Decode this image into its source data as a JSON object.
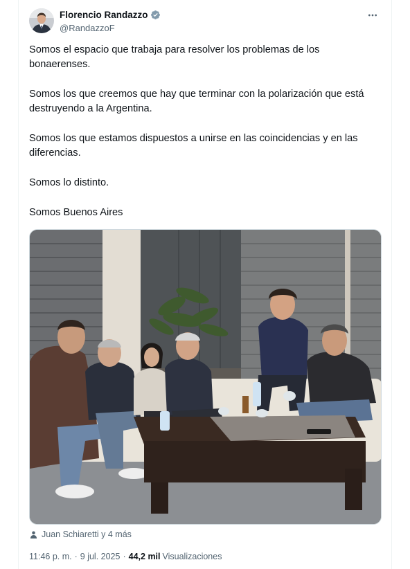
{
  "author": {
    "name": "Florencio Randazzo",
    "handle": "@RandazzoF"
  },
  "tweet": {
    "paragraphs": [
      "Somos el espacio que trabaja para resolver los problemas de los bonaerenses.",
      "Somos los que creemos que hay que terminar con la polarización que está destruyendo a la Argentina.",
      "Somos los que estamos dispuestos a unirse en las coincidencias y en las diferencias.",
      "Somos lo distinto.",
      "Somos Buenos Aires"
    ]
  },
  "tagged": {
    "label": "Juan Schiaretti y 4 más"
  },
  "meta": {
    "time": "11:46 p. m.",
    "separator": "·",
    "date": "9 jul. 2025",
    "views_count": "44,2 mil",
    "views_label": "Visualizaciones"
  },
  "colors": {
    "verified": "#1d9bf0",
    "secondary_text": "#536471",
    "primary_text": "#0f1419"
  },
  "icons": {
    "verified": "verified-badge-icon",
    "more": "more-horizontal-icon",
    "tagged": "person-icon"
  }
}
